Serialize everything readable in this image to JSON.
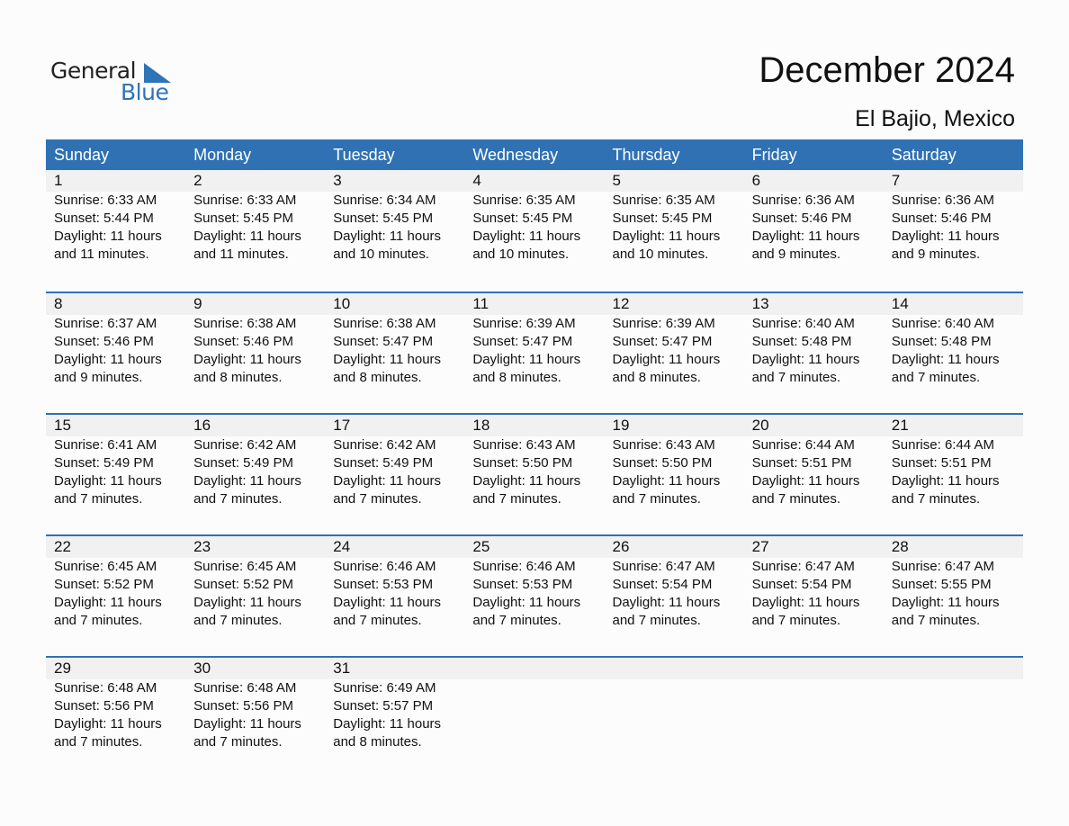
{
  "logo": {
    "word1": "General",
    "word2": "Blue"
  },
  "header": {
    "title": "December 2024",
    "location": "El Bajio, Mexico"
  },
  "weekdays": [
    "Sunday",
    "Monday",
    "Tuesday",
    "Wednesday",
    "Thursday",
    "Friday",
    "Saturday"
  ],
  "weeks": [
    [
      {
        "day": "1",
        "sunrise": "Sunrise: 6:33 AM",
        "sunset": "Sunset: 5:44 PM",
        "daylight": "Daylight: 11 hours",
        "minutes": "and 11 minutes."
      },
      {
        "day": "2",
        "sunrise": "Sunrise: 6:33 AM",
        "sunset": "Sunset: 5:45 PM",
        "daylight": "Daylight: 11 hours",
        "minutes": "and 11 minutes."
      },
      {
        "day": "3",
        "sunrise": "Sunrise: 6:34 AM",
        "sunset": "Sunset: 5:45 PM",
        "daylight": "Daylight: 11 hours",
        "minutes": "and 10 minutes."
      },
      {
        "day": "4",
        "sunrise": "Sunrise: 6:35 AM",
        "sunset": "Sunset: 5:45 PM",
        "daylight": "Daylight: 11 hours",
        "minutes": "and 10 minutes."
      },
      {
        "day": "5",
        "sunrise": "Sunrise: 6:35 AM",
        "sunset": "Sunset: 5:45 PM",
        "daylight": "Daylight: 11 hours",
        "minutes": "and 10 minutes."
      },
      {
        "day": "6",
        "sunrise": "Sunrise: 6:36 AM",
        "sunset": "Sunset: 5:46 PM",
        "daylight": "Daylight: 11 hours",
        "minutes": "and 9 minutes."
      },
      {
        "day": "7",
        "sunrise": "Sunrise: 6:36 AM",
        "sunset": "Sunset: 5:46 PM",
        "daylight": "Daylight: 11 hours",
        "minutes": "and 9 minutes."
      }
    ],
    [
      {
        "day": "8",
        "sunrise": "Sunrise: 6:37 AM",
        "sunset": "Sunset: 5:46 PM",
        "daylight": "Daylight: 11 hours",
        "minutes": "and 9 minutes."
      },
      {
        "day": "9",
        "sunrise": "Sunrise: 6:38 AM",
        "sunset": "Sunset: 5:46 PM",
        "daylight": "Daylight: 11 hours",
        "minutes": "and 8 minutes."
      },
      {
        "day": "10",
        "sunrise": "Sunrise: 6:38 AM",
        "sunset": "Sunset: 5:47 PM",
        "daylight": "Daylight: 11 hours",
        "minutes": "and 8 minutes."
      },
      {
        "day": "11",
        "sunrise": "Sunrise: 6:39 AM",
        "sunset": "Sunset: 5:47 PM",
        "daylight": "Daylight: 11 hours",
        "minutes": "and 8 minutes."
      },
      {
        "day": "12",
        "sunrise": "Sunrise: 6:39 AM",
        "sunset": "Sunset: 5:47 PM",
        "daylight": "Daylight: 11 hours",
        "minutes": "and 8 minutes."
      },
      {
        "day": "13",
        "sunrise": "Sunrise: 6:40 AM",
        "sunset": "Sunset: 5:48 PM",
        "daylight": "Daylight: 11 hours",
        "minutes": "and 7 minutes."
      },
      {
        "day": "14",
        "sunrise": "Sunrise: 6:40 AM",
        "sunset": "Sunset: 5:48 PM",
        "daylight": "Daylight: 11 hours",
        "minutes": "and 7 minutes."
      }
    ],
    [
      {
        "day": "15",
        "sunrise": "Sunrise: 6:41 AM",
        "sunset": "Sunset: 5:49 PM",
        "daylight": "Daylight: 11 hours",
        "minutes": "and 7 minutes."
      },
      {
        "day": "16",
        "sunrise": "Sunrise: 6:42 AM",
        "sunset": "Sunset: 5:49 PM",
        "daylight": "Daylight: 11 hours",
        "minutes": "and 7 minutes."
      },
      {
        "day": "17",
        "sunrise": "Sunrise: 6:42 AM",
        "sunset": "Sunset: 5:49 PM",
        "daylight": "Daylight: 11 hours",
        "minutes": "and 7 minutes."
      },
      {
        "day": "18",
        "sunrise": "Sunrise: 6:43 AM",
        "sunset": "Sunset: 5:50 PM",
        "daylight": "Daylight: 11 hours",
        "minutes": "and 7 minutes."
      },
      {
        "day": "19",
        "sunrise": "Sunrise: 6:43 AM",
        "sunset": "Sunset: 5:50 PM",
        "daylight": "Daylight: 11 hours",
        "minutes": "and 7 minutes."
      },
      {
        "day": "20",
        "sunrise": "Sunrise: 6:44 AM",
        "sunset": "Sunset: 5:51 PM",
        "daylight": "Daylight: 11 hours",
        "minutes": "and 7 minutes."
      },
      {
        "day": "21",
        "sunrise": "Sunrise: 6:44 AM",
        "sunset": "Sunset: 5:51 PM",
        "daylight": "Daylight: 11 hours",
        "minutes": "and 7 minutes."
      }
    ],
    [
      {
        "day": "22",
        "sunrise": "Sunrise: 6:45 AM",
        "sunset": "Sunset: 5:52 PM",
        "daylight": "Daylight: 11 hours",
        "minutes": "and 7 minutes."
      },
      {
        "day": "23",
        "sunrise": "Sunrise: 6:45 AM",
        "sunset": "Sunset: 5:52 PM",
        "daylight": "Daylight: 11 hours",
        "minutes": "and 7 minutes."
      },
      {
        "day": "24",
        "sunrise": "Sunrise: 6:46 AM",
        "sunset": "Sunset: 5:53 PM",
        "daylight": "Daylight: 11 hours",
        "minutes": "and 7 minutes."
      },
      {
        "day": "25",
        "sunrise": "Sunrise: 6:46 AM",
        "sunset": "Sunset: 5:53 PM",
        "daylight": "Daylight: 11 hours",
        "minutes": "and 7 minutes."
      },
      {
        "day": "26",
        "sunrise": "Sunrise: 6:47 AM",
        "sunset": "Sunset: 5:54 PM",
        "daylight": "Daylight: 11 hours",
        "minutes": "and 7 minutes."
      },
      {
        "day": "27",
        "sunrise": "Sunrise: 6:47 AM",
        "sunset": "Sunset: 5:54 PM",
        "daylight": "Daylight: 11 hours",
        "minutes": "and 7 minutes."
      },
      {
        "day": "28",
        "sunrise": "Sunrise: 6:47 AM",
        "sunset": "Sunset: 5:55 PM",
        "daylight": "Daylight: 11 hours",
        "minutes": "and 7 minutes."
      }
    ],
    [
      {
        "day": "29",
        "sunrise": "Sunrise: 6:48 AM",
        "sunset": "Sunset: 5:56 PM",
        "daylight": "Daylight: 11 hours",
        "minutes": "and 7 minutes."
      },
      {
        "day": "30",
        "sunrise": "Sunrise: 6:48 AM",
        "sunset": "Sunset: 5:56 PM",
        "daylight": "Daylight: 11 hours",
        "minutes": "and 7 minutes."
      },
      {
        "day": "31",
        "sunrise": "Sunrise: 6:49 AM",
        "sunset": "Sunset: 5:57 PM",
        "daylight": "Daylight: 11 hours",
        "minutes": "and 8 minutes."
      },
      null,
      null,
      null,
      null
    ]
  ],
  "colors": {
    "brand_blue": "#2f71b3",
    "band_gray": "#f1f1f1"
  }
}
